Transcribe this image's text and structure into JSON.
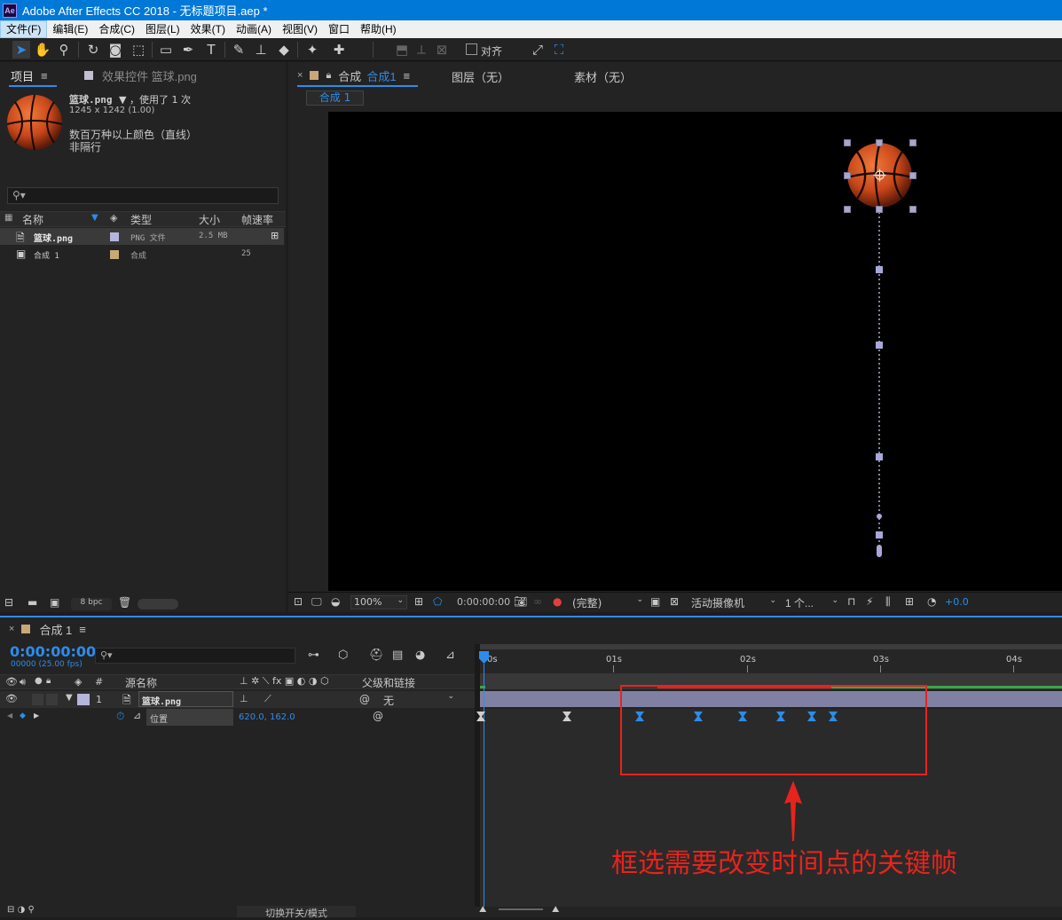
{
  "window": {
    "title": "Adobe After Effects CC 2018 - 无标题项目.aep *",
    "logo": "Ae"
  },
  "menu": [
    "文件(F)",
    "编辑(E)",
    "合成(C)",
    "图层(L)",
    "效果(T)",
    "动画(A)",
    "视图(V)",
    "窗口",
    "帮助(H)"
  ],
  "toolbar": {
    "snap_label": "对齐"
  },
  "project_panel": {
    "tab_project": "项目",
    "tab_effects": "效果控件 篮球.png",
    "preview": {
      "name": "篮球.png",
      "usage": "，使用了 1 次",
      "dimensions": "1245 x 1242 (1.00)",
      "color_info": "数百万种以上颜色（直线）",
      "interlace": "非隔行"
    },
    "search_placeholder": "",
    "columns": {
      "name": "名称",
      "type": "类型",
      "size": "大小",
      "fps": "帧速率"
    },
    "items": [
      {
        "name": "篮球.png",
        "type": "PNG 文件",
        "size": "2.5 MB",
        "fps": "",
        "label_color": "#b4b4dc"
      },
      {
        "name": "合成 1",
        "type": "合成",
        "size": "",
        "fps": "25",
        "label_color": "#c8a878"
      }
    ],
    "bpc": "8 bpc"
  },
  "comp_panel": {
    "tab_label": "合成",
    "tab_name": "合成1",
    "layer_tab": "图层（无）",
    "footage_tab": "素材（无）",
    "breadcrumb": "合成 1",
    "zoom": "100%",
    "timecode": "0:00:00:00",
    "resolution": "(完整)",
    "camera": "活动摄像机",
    "views": "1 个...",
    "exposure": "+0.0"
  },
  "timeline": {
    "tab_name": "合成 1",
    "timecode": "0:00:00:00",
    "frames": "00000 (25.00 fps)",
    "search_placeholder": "",
    "col_source": "源名称",
    "col_parent": "父级和链接",
    "layer": {
      "index": "1",
      "name": "篮球.png",
      "parent": "无"
    },
    "property": {
      "name": "位置",
      "value": "620.0, 162.0"
    },
    "ruler": [
      "0s",
      "01s",
      "02s",
      "03s",
      "04s"
    ],
    "bottom_label": "切换开关/模式"
  },
  "annotation": {
    "text": "框选需要改变时间点的关键帧",
    "color": "#e8231c"
  },
  "colors": {
    "accent": "#2d8ceb",
    "selection_box": "#e8231c",
    "work_area": "#9090b8"
  }
}
